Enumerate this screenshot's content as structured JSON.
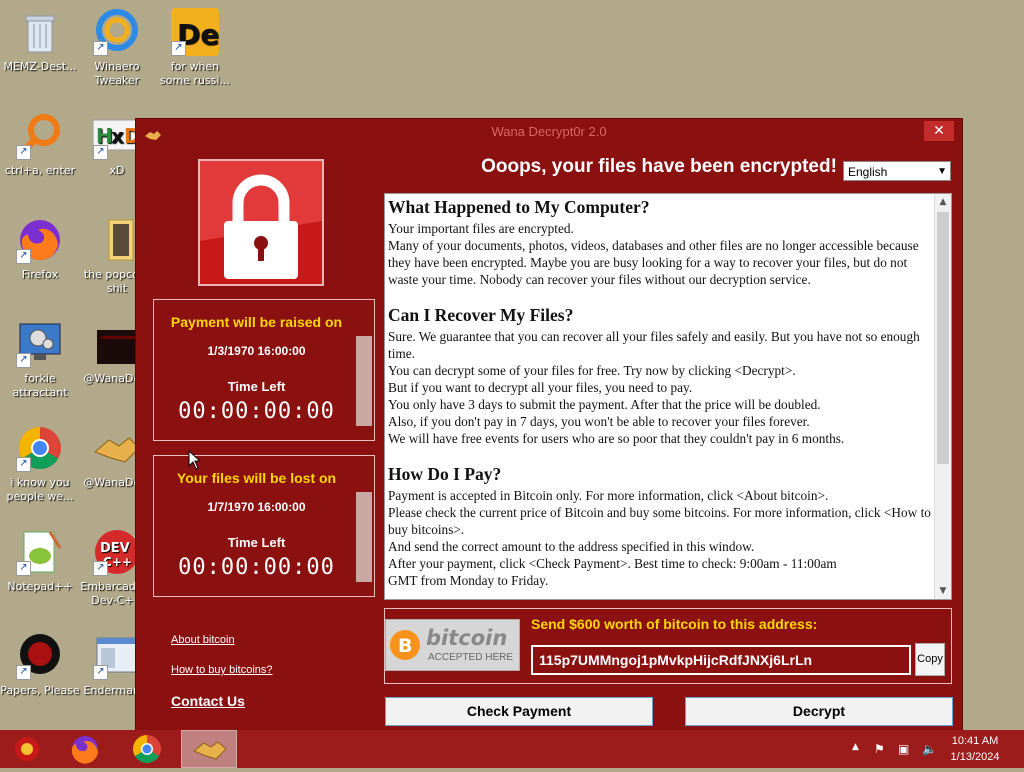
{
  "desktop": {
    "icons": [
      {
        "label": "MEMZ-Dest..."
      },
      {
        "label": "Winaero Tweaker"
      },
      {
        "label": "for when some russi..."
      },
      {
        "label": "ctrl+a, enter"
      },
      {
        "label": "xD"
      },
      {
        "label": "Firefox"
      },
      {
        "label": "the popcorn shit"
      },
      {
        "label": "forkie attractant"
      },
      {
        "label": "@WanaDe..."
      },
      {
        "label": "i know you people we..."
      },
      {
        "label": "@WanaDe..."
      },
      {
        "label": "Notepad++"
      },
      {
        "label": "Embarcadero Dev-C++"
      },
      {
        "label": "Papers, Please"
      },
      {
        "label": "Enderman..."
      }
    ]
  },
  "window": {
    "title": "Wana Decrypt0r 2.0",
    "close_label": "✕",
    "heading": "Ooops, your files have been encrypted!",
    "language": "English",
    "panel1": {
      "head": "Payment will be raised on",
      "date": "1/3/1970 16:00:00",
      "time_left_label": "Time Left",
      "timer": "00:00:00:00"
    },
    "panel2": {
      "head": "Your files will be lost on",
      "date": "1/7/1970 16:00:00",
      "time_left_label": "Time Left",
      "timer": "00:00:00:00"
    },
    "links": {
      "about_bitcoin": "About bitcoin",
      "how_to_buy": "How to buy bitcoins?",
      "contact_us": "Contact Us"
    },
    "content": {
      "s1_title": "What Happened to My Computer?",
      "s1_p1": "Your important files are encrypted.",
      "s1_p2": "Many of your documents, photos, videos, databases and other files are no longer accessible because they have been encrypted. Maybe you are busy looking for a way to recover your files, but do not waste your time. Nobody can recover your files without our decryption service.",
      "s2_title": "Can I Recover My Files?",
      "s2_p1": "Sure. We guarantee that you can recover all your files safely and easily. But you have not so enough time.",
      "s2_p2": "You can decrypt some of your files for free. Try now by clicking <Decrypt>.",
      "s2_p3": "But if you want to decrypt all your files, you need to pay.",
      "s2_p4": "You only have 3 days to submit the payment. After that the price will be doubled.",
      "s2_p5": "Also, if you don't pay in 7 days, you won't be able to recover your files forever.",
      "s2_p6": "We will have free events for users who are so poor that they couldn't pay in 6 months.",
      "s3_title": "How Do I Pay?",
      "s3_p1": "Payment is accepted in Bitcoin only. For more information, click <About bitcoin>.",
      "s3_p2": "Please check the current price of Bitcoin and buy some bitcoins. For more information, click <How to buy bitcoins>.",
      "s3_p3": "And send the correct amount to the address specified in this window.",
      "s3_p4": "After your payment, click <Check Payment>. Best time to check: 9:00am - 11:00am",
      "s3_p5": "GMT from Monday to Friday."
    },
    "bitcoin": {
      "word": "bitcoin",
      "accepted": "ACCEPTED HERE",
      "send_label": "Send $600 worth of bitcoin to this address:",
      "address": "115p7UMMngoj1pMvkpHijcRdfJNXj6LrLn",
      "copy_label": "Copy"
    },
    "buttons": {
      "check_payment": "Check Payment",
      "decrypt": "Decrypt"
    }
  },
  "taskbar": {
    "time": "10:41 AM",
    "date": "1/13/2024"
  }
}
